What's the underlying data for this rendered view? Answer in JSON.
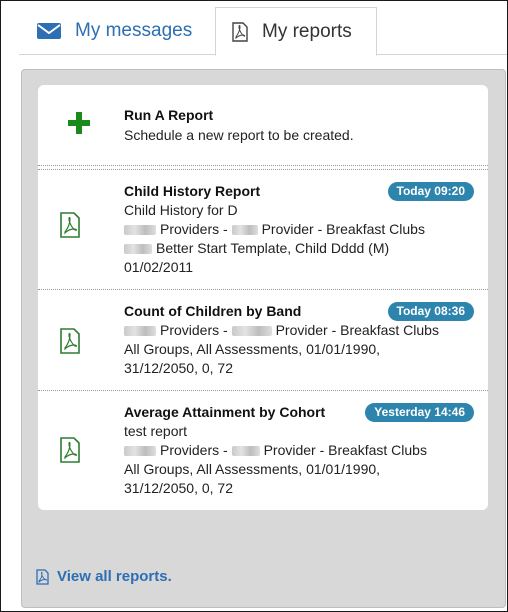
{
  "tabs": {
    "messages": {
      "label": "My messages",
      "icon": "envelope-icon"
    },
    "reports": {
      "label": "My reports",
      "icon": "pdf-file-icon"
    }
  },
  "run_report": {
    "title": "Run A Report",
    "subtitle": "Schedule a new report to be created.",
    "icon": "plus-icon",
    "icon_color": "#1a8a1a"
  },
  "reports": [
    {
      "title": "Child History Report",
      "badge": "Today 09:20",
      "line1": "Child History for D",
      "line2": "Providers - ",
      "line2b": "Provider - Breakfast Clubs",
      "line3": "Better Start Template, Child Dddd (M)",
      "line4": "01/02/2011"
    },
    {
      "title": "Count of Children by Band",
      "badge": "Today 08:36",
      "line2": "Providers - ",
      "line2b": "Provider - Breakfast Clubs",
      "line3": "All Groups, All Assessments, 01/01/1990,",
      "line4": "31/12/2050, 0, 72"
    },
    {
      "title": "Average Attainment by Cohort",
      "badge": "Yesterday 14:46",
      "line1": "test report",
      "line2": "Providers - ",
      "line2b": "Provider - Breakfast Clubs",
      "line3": "All Groups, All Assessments, 01/01/1990,",
      "line4": "31/12/2050, 0, 72"
    }
  ],
  "footer": {
    "label": "View all reports."
  },
  "colors": {
    "link": "#2c6fb3",
    "badge": "#2d85ad",
    "pdf_icon": "#2e7d32"
  }
}
